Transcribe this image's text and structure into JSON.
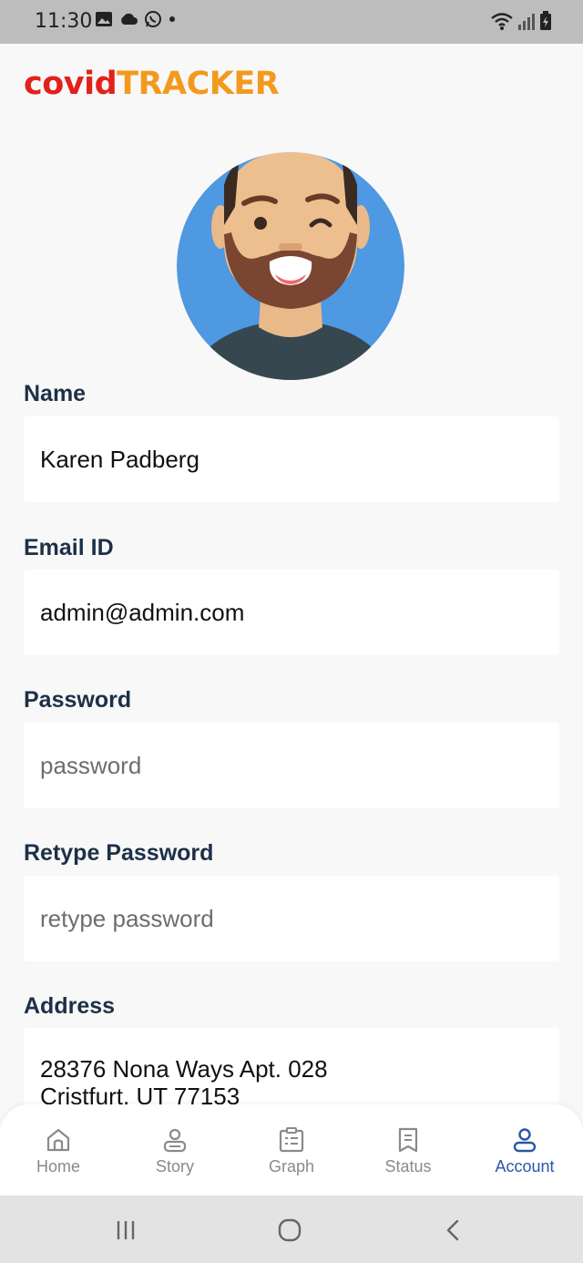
{
  "status_bar": {
    "time": "11:30",
    "left_icons": [
      "gallery-icon",
      "cloud-icon",
      "whatsapp-icon",
      "dot-icon"
    ],
    "right_icons": [
      "wifi-icon",
      "signal-icon",
      "battery-icon"
    ]
  },
  "app": {
    "logo_part1": "covid",
    "logo_part2": "TRACKER",
    "brand_red": "#e32119",
    "brand_orange": "#f39a1e"
  },
  "profile": {
    "avatar_icon": "avatar-winking-man"
  },
  "form": {
    "name": {
      "label": "Name",
      "value": "Karen Padberg",
      "placeholder": ""
    },
    "email": {
      "label": "Email ID",
      "value": "admin@admin.com",
      "placeholder": ""
    },
    "password": {
      "label": "Password",
      "value": "",
      "placeholder": "password"
    },
    "retype_password": {
      "label": "Retype Password",
      "value": "",
      "placeholder": "retype password"
    },
    "address": {
      "label": "Address",
      "value": "28376 Nona Ways Apt. 028\nCristfurt, UT 77153"
    }
  },
  "bottom_nav": {
    "active": "Account",
    "active_color": "#2a56a8",
    "items": [
      {
        "label": "Home",
        "icon": "home-icon"
      },
      {
        "label": "Story",
        "icon": "story-icon"
      },
      {
        "label": "Graph",
        "icon": "graph-icon"
      },
      {
        "label": "Status",
        "icon": "status-icon"
      },
      {
        "label": "Account",
        "icon": "account-icon"
      }
    ]
  },
  "system_nav": [
    "recents-icon",
    "home-circle-icon",
    "back-icon"
  ]
}
